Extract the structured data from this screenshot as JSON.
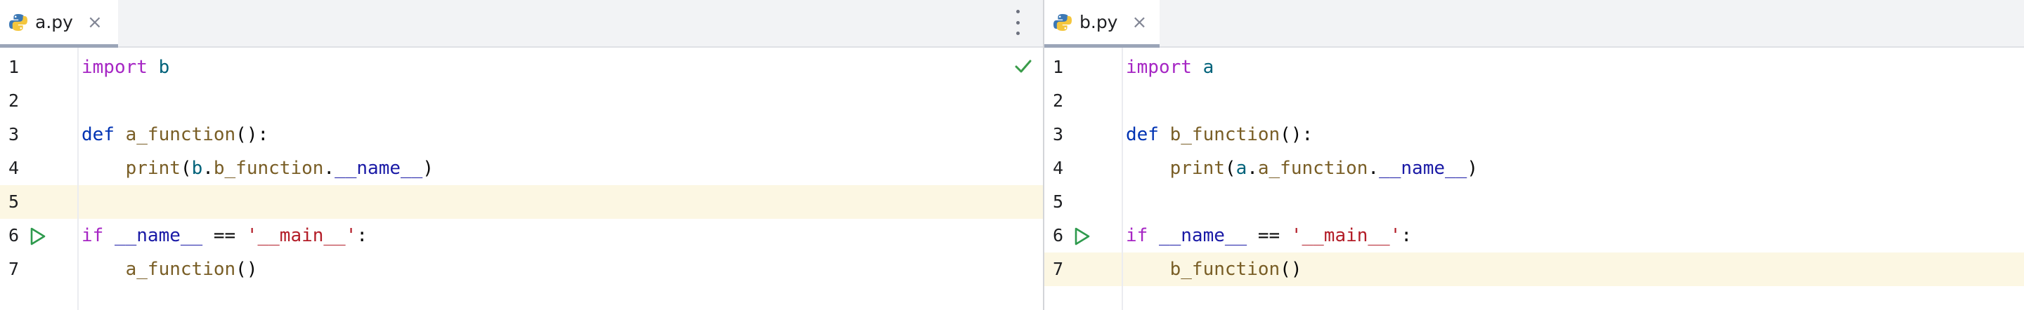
{
  "left_pane": {
    "tab": {
      "filename": "a.py",
      "close": "×"
    },
    "lines": [
      {
        "number": "1",
        "tokens": [
          {
            "t": "import",
            "c": "kw2"
          },
          {
            "t": " ",
            "c": "pun"
          },
          {
            "t": "b",
            "c": "mod"
          }
        ]
      },
      {
        "number": "2",
        "tokens": []
      },
      {
        "number": "3",
        "tokens": [
          {
            "t": "def",
            "c": "kw"
          },
          {
            "t": " ",
            "c": "pun"
          },
          {
            "t": "a_function",
            "c": "fn"
          },
          {
            "t": "():",
            "c": "pun"
          }
        ]
      },
      {
        "number": "4",
        "tokens": [
          {
            "t": "    ",
            "c": "pun"
          },
          {
            "t": "print",
            "c": "fn"
          },
          {
            "t": "(",
            "c": "pun"
          },
          {
            "t": "b",
            "c": "mod"
          },
          {
            "t": ".",
            "c": "pun"
          },
          {
            "t": "b_function",
            "c": "fn"
          },
          {
            "t": ".",
            "c": "pun"
          },
          {
            "t": "__name__",
            "c": "dunder"
          },
          {
            "t": ")",
            "c": "pun"
          }
        ]
      },
      {
        "number": "5",
        "tokens": [],
        "caret": true
      },
      {
        "number": "6",
        "tokens": [
          {
            "t": "if",
            "c": "kw2"
          },
          {
            "t": " ",
            "c": "pun"
          },
          {
            "t": "__name__",
            "c": "dunder"
          },
          {
            "t": " == ",
            "c": "pun"
          },
          {
            "t": "'__main__'",
            "c": "str"
          },
          {
            "t": ":",
            "c": "pun"
          }
        ],
        "run": true
      },
      {
        "number": "7",
        "tokens": [
          {
            "t": "    ",
            "c": "pun"
          },
          {
            "t": "a_function",
            "c": "fn"
          },
          {
            "t": "()",
            "c": "pun"
          }
        ]
      }
    ],
    "inspection_ok": true
  },
  "right_pane": {
    "tab": {
      "filename": "b.py",
      "close": "×"
    },
    "lines": [
      {
        "number": "1",
        "tokens": [
          {
            "t": "import",
            "c": "kw2"
          },
          {
            "t": " ",
            "c": "pun"
          },
          {
            "t": "a",
            "c": "mod"
          }
        ]
      },
      {
        "number": "2",
        "tokens": []
      },
      {
        "number": "3",
        "tokens": [
          {
            "t": "def",
            "c": "kw"
          },
          {
            "t": " ",
            "c": "pun"
          },
          {
            "t": "b_function",
            "c": "fn"
          },
          {
            "t": "():",
            "c": "pun"
          }
        ]
      },
      {
        "number": "4",
        "tokens": [
          {
            "t": "    ",
            "c": "pun"
          },
          {
            "t": "print",
            "c": "fn"
          },
          {
            "t": "(",
            "c": "pun"
          },
          {
            "t": "a",
            "c": "mod"
          },
          {
            "t": ".",
            "c": "pun"
          },
          {
            "t": "a_function",
            "c": "fn"
          },
          {
            "t": ".",
            "c": "pun"
          },
          {
            "t": "__name__",
            "c": "dunder"
          },
          {
            "t": ")",
            "c": "pun"
          }
        ]
      },
      {
        "number": "5",
        "tokens": []
      },
      {
        "number": "6",
        "tokens": [
          {
            "t": "if",
            "c": "kw2"
          },
          {
            "t": " ",
            "c": "pun"
          },
          {
            "t": "__name__",
            "c": "dunder"
          },
          {
            "t": " == ",
            "c": "pun"
          },
          {
            "t": "'__main__'",
            "c": "str"
          },
          {
            "t": ":",
            "c": "pun"
          }
        ],
        "run": true
      },
      {
        "number": "7",
        "tokens": [
          {
            "t": "    ",
            "c": "pun"
          },
          {
            "t": "b_function",
            "c": "fn"
          },
          {
            "t": "()",
            "c": "pun"
          }
        ],
        "caret": true
      }
    ]
  },
  "icons": {
    "file_type": "python-file-icon",
    "run_gutter": "run-triangle-icon",
    "inspection": "checkmark-icon",
    "tab_options": "more-vertical-icon"
  },
  "colors": {
    "caret_row": "#fcf7e3",
    "run_icon": "#2e9a4d",
    "check_icon": "#3a9c4a",
    "tab_underline": "#9ba5b8"
  }
}
